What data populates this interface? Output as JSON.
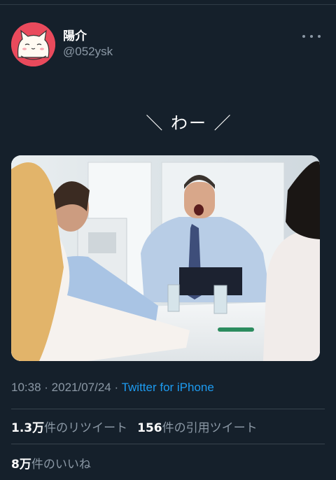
{
  "author": {
    "display_name": "陽介",
    "handle": "@052ysk"
  },
  "tweet": {
    "text": "＼ わー ／"
  },
  "meta": {
    "time": "10:38",
    "sep1": " · ",
    "date": "2021/07/24",
    "sep2": " · ",
    "source": "Twitter for iPhone"
  },
  "stats": {
    "retweets_count": "1.3万",
    "retweets_label": "件のリツイート",
    "quotes_count": "156",
    "quotes_label": "件の引用ツイート",
    "likes_count": "8万",
    "likes_label": "件のいいね"
  },
  "icons": {
    "more": "more-dots-icon",
    "avatar": "cat-avatar"
  }
}
